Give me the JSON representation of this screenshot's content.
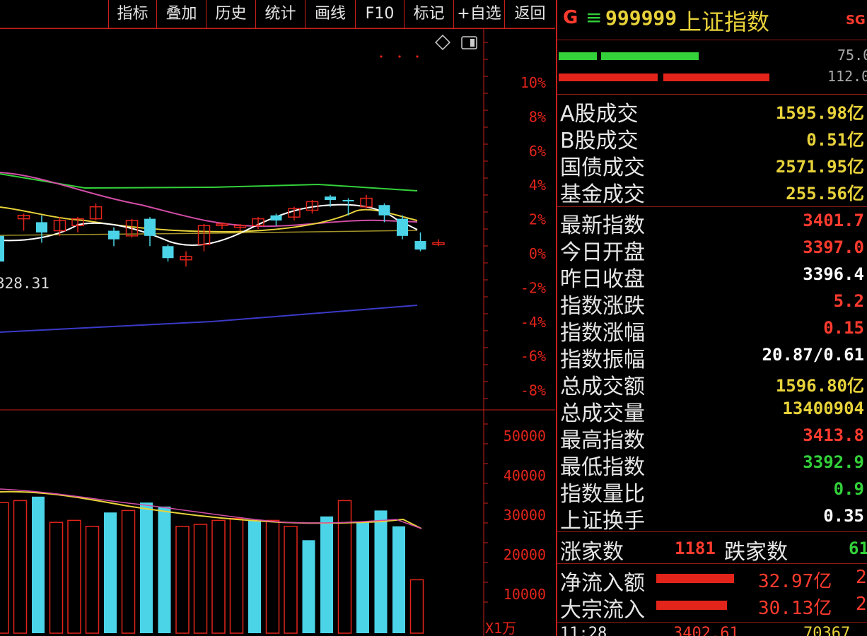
{
  "toolbar": {
    "buttons": [
      "指标",
      "叠加",
      "历史",
      "统计",
      "画线",
      "F10",
      "标记",
      "+自选",
      "返回"
    ]
  },
  "header": {
    "g_label": "G",
    "menu_glyph": "≡",
    "code": "999999",
    "name": "上证指数",
    "badge": "SG"
  },
  "order_bars": {
    "top_value": "75.0",
    "bottom_value": "112.0"
  },
  "turnover": [
    {
      "label": "A股成交",
      "value": "1595.98亿",
      "color": "#e8d23a"
    },
    {
      "label": "B股成交",
      "value": "0.51亿",
      "color": "#e8d23a"
    },
    {
      "label": "国债成交",
      "value": "2571.95亿",
      "color": "#e8d23a"
    },
    {
      "label": "基金成交",
      "value": "255.56亿",
      "color": "#e8d23a"
    }
  ],
  "quote": [
    {
      "label": "最新指数",
      "value": "3401.7",
      "color": "#ff3b2e"
    },
    {
      "label": "今日开盘",
      "value": "3397.0",
      "color": "#ff3b2e"
    },
    {
      "label": "昨日收盘",
      "value": "3396.4",
      "color": "#ffffff"
    },
    {
      "label": "指数涨跌",
      "value": "5.2",
      "color": "#ff3b2e"
    },
    {
      "label": "指数涨幅",
      "value": "0.15",
      "color": "#ff3b2e"
    },
    {
      "label": "指数振幅",
      "value": "20.87/0.61",
      "color": "#ffffff"
    },
    {
      "label": "总成交额",
      "value": "1596.80亿",
      "color": "#e8d23a"
    },
    {
      "label": "总成交量",
      "value": "13400904",
      "color": "#e8d23a"
    },
    {
      "label": "最高指数",
      "value": "3413.8",
      "color": "#ff3b2e"
    },
    {
      "label": "最低指数",
      "value": "3392.9",
      "color": "#33d13a"
    },
    {
      "label": "指数量比",
      "value": "0.9",
      "color": "#33d13a"
    },
    {
      "label": "上证换手",
      "value": "0.35",
      "color": "#ffffff"
    }
  ],
  "breadth": {
    "up_label": "涨家数",
    "up_value": "1181",
    "down_label": "跌家数",
    "down_value": "61"
  },
  "flows": [
    {
      "label": "净流入额",
      "value": "32.97亿",
      "extra": "2"
    },
    {
      "label": "大宗流入",
      "value": "30.13亿",
      "extra": "2"
    }
  ],
  "tick": {
    "time": "11:28",
    "price": "3402.61",
    "vol": "70367"
  },
  "chart_data": {
    "type": "candlestick",
    "price_axis_labels": [
      "10%",
      "8%",
      "6%",
      "4%",
      "2%",
      "0%",
      "-2%",
      "-4%",
      "-6%",
      "-8%"
    ],
    "low_label": "328.31",
    "volume_axis_labels": [
      "50000",
      "40000",
      "30000",
      "20000",
      "10000"
    ],
    "volume_unit": "X1万",
    "candles": [
      {
        "o": 1.0,
        "c": -0.5,
        "h": 1.2,
        "l": -0.8,
        "up": false
      },
      {
        "o": 2.0,
        "c": 2.2,
        "h": 2.3,
        "l": 1.3,
        "up": true
      },
      {
        "o": 1.8,
        "c": 1.2,
        "h": 2.2,
        "l": 0.6,
        "up": false
      },
      {
        "o": 1.3,
        "c": 1.9,
        "h": 2.1,
        "l": 1.0,
        "up": true
      },
      {
        "o": 1.6,
        "c": 2.0,
        "h": 2.1,
        "l": 1.2,
        "up": true
      },
      {
        "o": 2.0,
        "c": 2.7,
        "h": 2.9,
        "l": 1.9,
        "up": true
      },
      {
        "o": 1.3,
        "c": 0.8,
        "h": 1.5,
        "l": 0.4,
        "up": false
      },
      {
        "o": 1.0,
        "c": 1.9,
        "h": 2.0,
        "l": 0.9,
        "up": true
      },
      {
        "o": 2.0,
        "c": 1.0,
        "h": 2.1,
        "l": 0.4,
        "up": false
      },
      {
        "o": 0.4,
        "c": -0.3,
        "h": 0.5,
        "l": -0.5,
        "up": false
      },
      {
        "o": -0.4,
        "c": -0.2,
        "h": 0.1,
        "l": -0.8,
        "up": true
      },
      {
        "o": 0.5,
        "c": 1.6,
        "h": 1.7,
        "l": 0.1,
        "up": true
      },
      {
        "o": 1.7,
        "c": 1.6,
        "h": 1.8,
        "l": 1.4,
        "up": true
      },
      {
        "o": 1.6,
        "c": 1.5,
        "h": 1.7,
        "l": 1.3,
        "up": true
      },
      {
        "o": 1.6,
        "c": 2.0,
        "h": 2.1,
        "l": 1.4,
        "up": true
      },
      {
        "o": 2.2,
        "c": 1.9,
        "h": 2.3,
        "l": 1.6,
        "up": false
      },
      {
        "o": 2.1,
        "c": 2.6,
        "h": 2.7,
        "l": 1.9,
        "up": true
      },
      {
        "o": 2.5,
        "c": 3.0,
        "h": 3.1,
        "l": 2.3,
        "up": true
      },
      {
        "o": 3.3,
        "c": 3.1,
        "h": 3.4,
        "l": 2.7,
        "up": false
      },
      {
        "o": 3.1,
        "c": 3.1,
        "h": 3.2,
        "l": 2.2,
        "up": false
      },
      {
        "o": 2.7,
        "c": 3.2,
        "h": 3.4,
        "l": 2.6,
        "up": true
      },
      {
        "o": 2.8,
        "c": 2.2,
        "h": 2.9,
        "l": 1.8,
        "up": false
      },
      {
        "o": 2.0,
        "c": 1.0,
        "h": 2.2,
        "l": 0.8,
        "up": false
      },
      {
        "o": 0.7,
        "c": 0.2,
        "h": 1.2,
        "l": 0.1,
        "up": false
      },
      {
        "o": 0.5,
        "c": 0.6,
        "h": 0.8,
        "l": 0.4,
        "up": true
      }
    ],
    "volumes": [
      {
        "v": 33000,
        "up": true
      },
      {
        "v": 33500,
        "up": true
      },
      {
        "v": 34500,
        "up": false
      },
      {
        "v": 28000,
        "up": true
      },
      {
        "v": 28500,
        "up": true
      },
      {
        "v": 27000,
        "up": true
      },
      {
        "v": 30500,
        "up": false
      },
      {
        "v": 31000,
        "up": true
      },
      {
        "v": 33000,
        "up": false
      },
      {
        "v": 32000,
        "up": false
      },
      {
        "v": 27000,
        "up": true
      },
      {
        "v": 27500,
        "up": true
      },
      {
        "v": 28500,
        "up": true
      },
      {
        "v": 29000,
        "up": true
      },
      {
        "v": 28500,
        "up": false
      },
      {
        "v": 28500,
        "up": true
      },
      {
        "v": 27000,
        "up": true
      },
      {
        "v": 23500,
        "up": false
      },
      {
        "v": 29500,
        "up": false
      },
      {
        "v": 33500,
        "up": true
      },
      {
        "v": 28000,
        "up": false
      },
      {
        "v": 31000,
        "up": false
      },
      {
        "v": 27000,
        "up": false
      },
      {
        "v": 13500,
        "up": true
      }
    ]
  },
  "colors": {
    "up": "#e2241a",
    "down": "#4bd4e8",
    "grid": "#c8201a",
    "ma_green": "#33d13a",
    "ma_pink": "#d24da6",
    "ma_yellow": "#e8d23a",
    "ma_white": "#ffffff",
    "ma_blue": "#3a3ac8"
  }
}
